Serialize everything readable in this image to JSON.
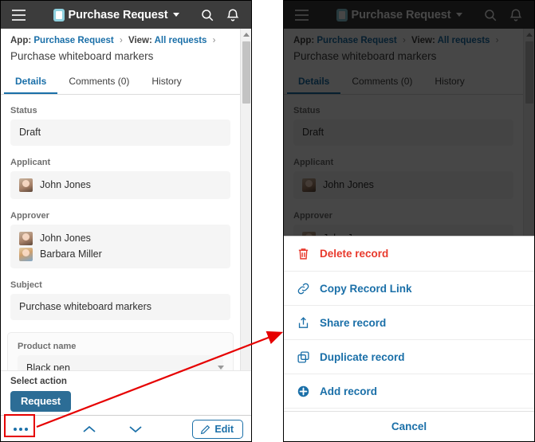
{
  "appbar": {
    "menu_icon": "hamburger-icon",
    "app_icon": "app-icon",
    "title": "Purchase Request",
    "caret": "chevron-down-icon",
    "search_icon": "search-icon",
    "bell_icon": "notification-bell-icon"
  },
  "breadcrumb": {
    "app_prefix": "App:",
    "app_name": "Purchase Request",
    "view_prefix": "View:",
    "view_name": "All requests",
    "separator": "›"
  },
  "record": {
    "title": "Purchase whiteboard markers"
  },
  "tabs": [
    {
      "label": "Details",
      "active": true
    },
    {
      "label": "Comments (0)",
      "active": false
    },
    {
      "label": "History",
      "active": false
    }
  ],
  "fields": {
    "status": {
      "label": "Status",
      "value": "Draft"
    },
    "applicant": {
      "label": "Applicant",
      "people": [
        "John Jones"
      ]
    },
    "approver": {
      "label": "Approver",
      "people": [
        "John Jones",
        "Barbara Miller"
      ]
    },
    "subject": {
      "label": "Subject",
      "value": "Purchase whiteboard markers"
    },
    "product_name": {
      "label": "Product name",
      "value": "Black pen"
    }
  },
  "action_area": {
    "label": "Select action",
    "button": "Request"
  },
  "bottombar": {
    "more_label": "more-options",
    "prev_label": "previous-record",
    "next_label": "next-record",
    "edit_label": "Edit",
    "edit_icon": "pencil-icon"
  },
  "action_sheet": {
    "items": [
      {
        "label": "Delete record",
        "icon": "trash-icon",
        "danger": true
      },
      {
        "label": "Copy Record Link",
        "icon": "link-icon",
        "danger": false
      },
      {
        "label": "Share record",
        "icon": "share-icon",
        "danger": false
      },
      {
        "label": "Duplicate record",
        "icon": "duplicate-icon",
        "danger": false
      },
      {
        "label": "Add record",
        "icon": "plus-circle-icon",
        "danger": false
      }
    ],
    "cancel": "Cancel"
  },
  "colors": {
    "appbar_bg": "#3c3c3c",
    "link_blue": "#1a6fa8",
    "danger_red": "#e8392c",
    "button_blue": "#2c6d96",
    "annotation_red": "#e60000",
    "field_bg": "#f5f5f5"
  }
}
